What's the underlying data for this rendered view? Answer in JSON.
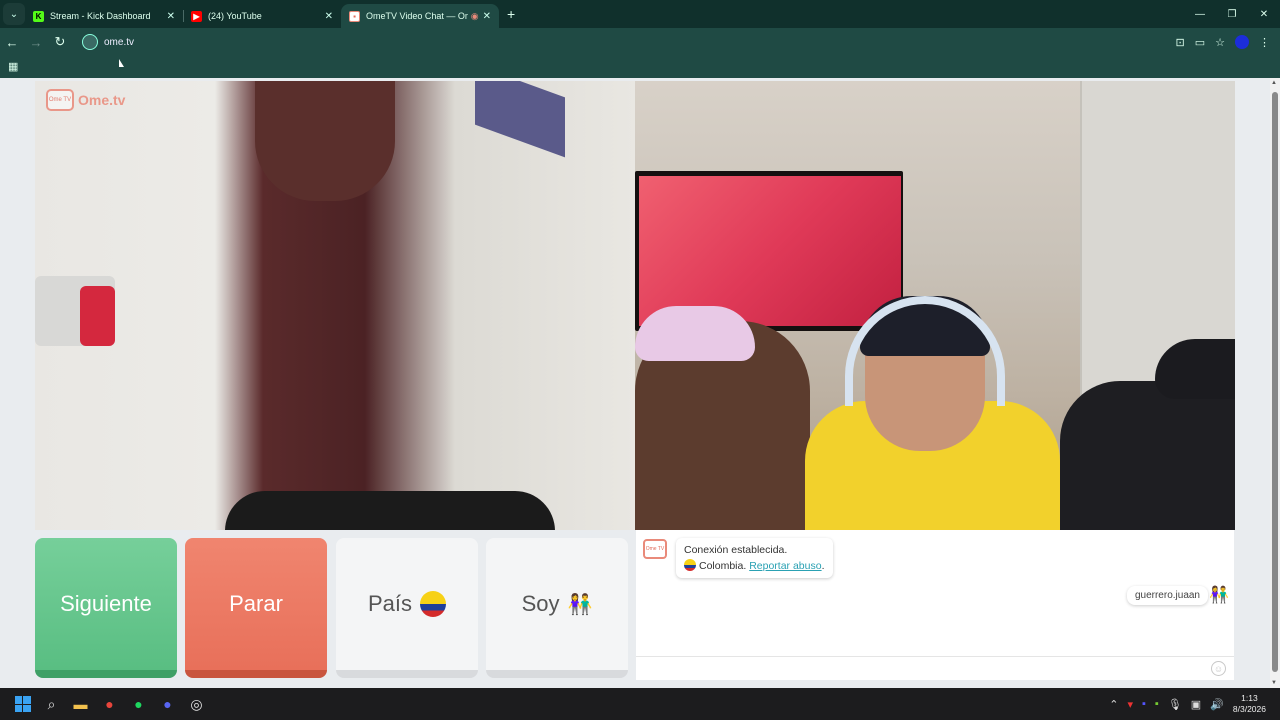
{
  "browser": {
    "tabs": [
      {
        "title": "Stream - Kick Dashboard",
        "favicon": "kick-icon",
        "color": "#53fc18"
      },
      {
        "title": "(24) YouTube",
        "favicon": "youtube-icon",
        "color": "#ff0000"
      },
      {
        "title": "OmeTV Video Chat — Ome",
        "favicon": "ometv-icon",
        "color": "#e98a7a",
        "active": true
      }
    ],
    "url": "ome.tv"
  },
  "page": {
    "logo_text": "Ome.tv",
    "logo_small": "Ome TV",
    "buttons": {
      "next": "Siguiente",
      "stop": "Parar",
      "country": "País",
      "me": "Soy"
    },
    "chat": {
      "system_line1": "Conexión establecida.",
      "country": "Colombia.",
      "report": "Reportar abuso",
      "report_suffix": ".",
      "user_message": "guerrero.juaan"
    }
  },
  "taskbar": {
    "time": "1:13",
    "date": "8/3/2026"
  },
  "colors": {
    "chrome_dark": "#10302c",
    "chrome_toolbar": "#1f4a44",
    "next_green": "#59be82",
    "stop_red": "#e8705a",
    "link_teal": "#2aa1b3"
  }
}
